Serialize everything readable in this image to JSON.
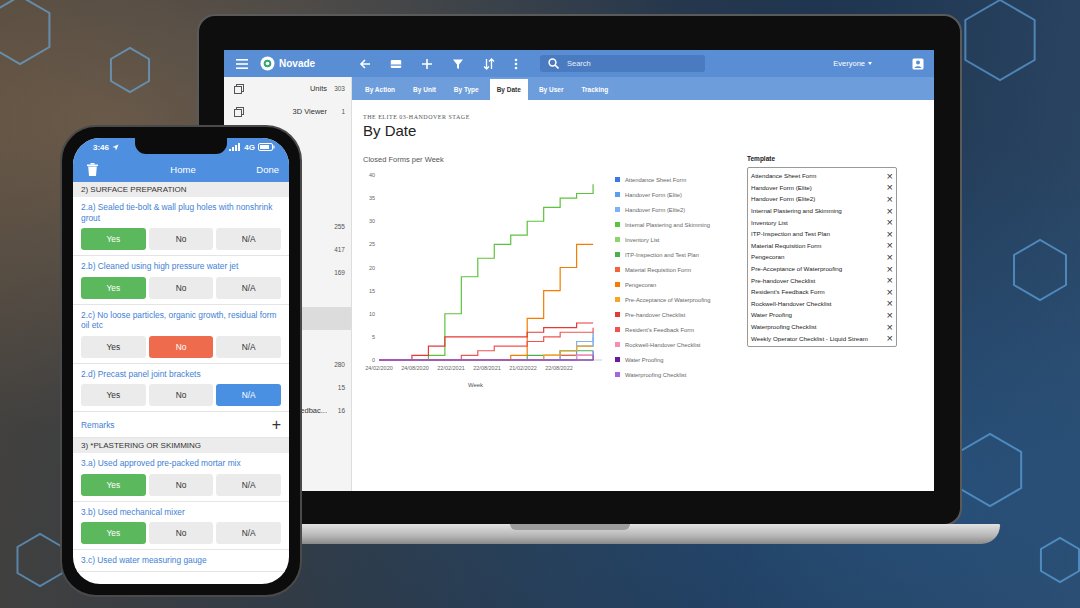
{
  "laptop_app": {
    "brand": "Novade",
    "search": {
      "placeholder": "Search"
    },
    "user_filter": "Everyone",
    "sidebar": {
      "items": [
        {
          "label": "Units",
          "count": "303",
          "selected": false
        },
        {
          "label": "3D Viewer",
          "count": "1",
          "selected": false
        },
        {
          "label": "",
          "count": "",
          "selected": false
        },
        {
          "label": "",
          "count": "",
          "selected": false
        },
        {
          "label": "",
          "count": "",
          "selected": false
        },
        {
          "label": "",
          "count": "",
          "selected": false
        },
        {
          "label": "",
          "count": "255",
          "selected": false
        },
        {
          "label": "",
          "count": "417",
          "selected": false
        },
        {
          "label": "",
          "count": "169",
          "selected": false
        },
        {
          "label": "",
          "count": "",
          "selected": false
        },
        {
          "label": "",
          "count": "",
          "selected": true
        },
        {
          "label": "",
          "count": "",
          "selected": false
        },
        {
          "label": "",
          "count": "280",
          "selected": false
        },
        {
          "label": "",
          "count": "15",
          "selected": false
        },
        {
          "label": "edbac...",
          "count": "16",
          "selected": false
        }
      ]
    },
    "tabs": [
      {
        "label": "By Action",
        "selected": false
      },
      {
        "label": "By Unit",
        "selected": false
      },
      {
        "label": "By Type",
        "selected": false
      },
      {
        "label": "By Date",
        "selected": true
      },
      {
        "label": "By User",
        "selected": false
      },
      {
        "label": "Tracking",
        "selected": false
      }
    ],
    "page": {
      "breadcrumb": "THE ELITE 03-HANDOVER STAGE",
      "title": "By Date"
    },
    "chart": {
      "title": "Closed Forms per Week",
      "y_ticks": [
        "0",
        "5",
        "10",
        "15",
        "20",
        "25",
        "30",
        "35",
        "40"
      ],
      "x_ticks": [
        "24/02/2020",
        "24/08/2020",
        "22/02/2021",
        "22/08/2021",
        "21/02/2022",
        "22/08/2022"
      ],
      "x_label": "Week",
      "series": [
        {
          "name": "Attendance Sheet Form",
          "color": "#3b78e7",
          "values": [
            0,
            0,
            0,
            0,
            0,
            0,
            0,
            0,
            0,
            0,
            0,
            0,
            1,
            2
          ]
        },
        {
          "name": "Handover Form (Elite)",
          "color": "#5b9bf0",
          "values": [
            0,
            0,
            0,
            0,
            0,
            0,
            0,
            0,
            0,
            0,
            0,
            1,
            3,
            6
          ]
        },
        {
          "name": "Handover Form (Elite2)",
          "color": "#7fb2f5",
          "values": [
            0,
            0,
            0,
            0,
            0,
            0,
            0,
            0,
            0,
            0,
            0,
            2,
            4,
            5
          ]
        },
        {
          "name": "Internal Plastering and Skimming",
          "color": "#5cc33c",
          "values": [
            0,
            0,
            0,
            1,
            10,
            18,
            22,
            25,
            27,
            30,
            33,
            35,
            36,
            38
          ]
        },
        {
          "name": "Inventory List",
          "color": "#8bd36a",
          "values": [
            0,
            0,
            0,
            0,
            0,
            0,
            0,
            0,
            0,
            0,
            0,
            0,
            0,
            0
          ]
        },
        {
          "name": "ITP-Inspection and Test Plan",
          "color": "#4caf50",
          "values": [
            0,
            0,
            0,
            0,
            0,
            0,
            0,
            0,
            0,
            1,
            1,
            2,
            2,
            2
          ]
        },
        {
          "name": "Material Requisition Form",
          "color": "#f0643c",
          "values": [
            0,
            0,
            0,
            0,
            0,
            0,
            0,
            0,
            0,
            0,
            1,
            1,
            1,
            1
          ]
        },
        {
          "name": "Pengecoran",
          "color": "#f57c00",
          "values": [
            0,
            0,
            0,
            0,
            0,
            0,
            0,
            0,
            1,
            9,
            15,
            20,
            25,
            25
          ]
        },
        {
          "name": "Pre-Acceptance of Waterproofing",
          "color": "#f5a623",
          "values": [
            0,
            0,
            0,
            0,
            0,
            0,
            0,
            0,
            0,
            0,
            1,
            2,
            3,
            3
          ]
        },
        {
          "name": "Pre-handover Checklist",
          "color": "#e53935",
          "values": [
            0,
            0,
            1,
            3,
            5,
            5,
            5,
            5,
            5,
            6,
            7,
            7,
            8,
            8
          ]
        },
        {
          "name": "Resident's Feedback Form",
          "color": "#ef5350",
          "values": [
            0,
            0,
            0,
            0,
            0,
            1,
            2,
            3,
            3,
            4,
            5,
            6,
            6,
            7
          ]
        },
        {
          "name": "Rockwell-Handover Checklist",
          "color": "#f48fb1",
          "values": [
            0,
            0,
            0,
            0,
            0,
            0,
            0,
            0,
            0,
            0,
            0,
            0,
            1,
            1
          ]
        },
        {
          "name": "Water Proofing",
          "color": "#6a1b9a",
          "values": [
            0,
            0,
            0,
            0,
            0,
            0,
            0,
            0,
            0,
            0,
            0,
            0,
            0,
            1
          ]
        },
        {
          "name": "Waterproofing Checklist",
          "color": "#9c6ade",
          "values": [
            0,
            0,
            0,
            0,
            0,
            0,
            0,
            0,
            0,
            0,
            0,
            0,
            0,
            0
          ]
        }
      ]
    },
    "template_filter": {
      "title": "Template",
      "remove_icon": "×",
      "items": [
        "Attendance Sheet Form",
        "Handover Form (Elite)",
        "Handover Form (Elite2)",
        "Internal Plastering and Skimming",
        "Inventory List",
        "ITP-Inspection and Test Plan",
        "Material Requisition Form",
        "Pengecoran",
        "Pre-Acceptance of Waterproofing",
        "Pre-handover Checklist",
        "Resident's Feedback Form",
        "Rockwell-Handover Checklist",
        "Water Proofing",
        "Waterproofing Checklist",
        "Weekly Operator Checklist - Liquid Stream"
      ]
    }
  },
  "phone_app": {
    "status_bar": {
      "time": "3:46",
      "network": "4G"
    },
    "header": {
      "title": "Home",
      "done": "Done"
    },
    "sections": [
      {
        "title": "2) SURFACE PREPARATION",
        "questions": [
          {
            "label": "2.a) Sealed tie-bolt & wall plug holes with nonshrink grout",
            "options": [
              {
                "label": "Yes",
                "selected": true,
                "color": "#5cb85c"
              },
              {
                "label": "No",
                "selected": false,
                "color": "#ee6b4d"
              },
              {
                "label": "N/A",
                "selected": false,
                "color": "#4a90e2"
              }
            ]
          },
          {
            "label": "2.b) Cleaned using high pressure water jet",
            "options": [
              {
                "label": "Yes",
                "selected": true,
                "color": "#5cb85c"
              },
              {
                "label": "No",
                "selected": false,
                "color": "#ee6b4d"
              },
              {
                "label": "N/A",
                "selected": false,
                "color": "#4a90e2"
              }
            ]
          },
          {
            "label": "2.c) No loose particles, organic growth, residual form oil etc",
            "options": [
              {
                "label": "Yes",
                "selected": false,
                "color": "#5cb85c"
              },
              {
                "label": "No",
                "selected": true,
                "color": "#ee6b4d"
              },
              {
                "label": "N/A",
                "selected": false,
                "color": "#4a90e2"
              }
            ]
          },
          {
            "label": "2.d) Precast panel joint brackets",
            "options": [
              {
                "label": "Yes",
                "selected": false,
                "color": "#5cb85c"
              },
              {
                "label": "No",
                "selected": false,
                "color": "#ee6b4d"
              },
              {
                "label": "N/A",
                "selected": true,
                "color": "#4a90e2"
              }
            ]
          }
        ],
        "remarks": {
          "label": "Remarks",
          "add": "+"
        }
      },
      {
        "title": "3) *PLASTERING OR SKIMMING",
        "questions": [
          {
            "label": "3.a) Used approved pre-packed mortar mix",
            "options": [
              {
                "label": "Yes",
                "selected": true,
                "color": "#5cb85c"
              },
              {
                "label": "No",
                "selected": false,
                "color": "#ee6b4d"
              },
              {
                "label": "N/A",
                "selected": false,
                "color": "#4a90e2"
              }
            ]
          },
          {
            "label": "3.b) Used mechanical mixer",
            "options": [
              {
                "label": "Yes",
                "selected": true,
                "color": "#5cb85c"
              },
              {
                "label": "No",
                "selected": false,
                "color": "#ee6b4d"
              },
              {
                "label": "N/A",
                "selected": false,
                "color": "#4a90e2"
              }
            ]
          },
          {
            "label": "3.c) Used water measuring gauge",
            "options": []
          }
        ],
        "remarks": null
      }
    ]
  }
}
